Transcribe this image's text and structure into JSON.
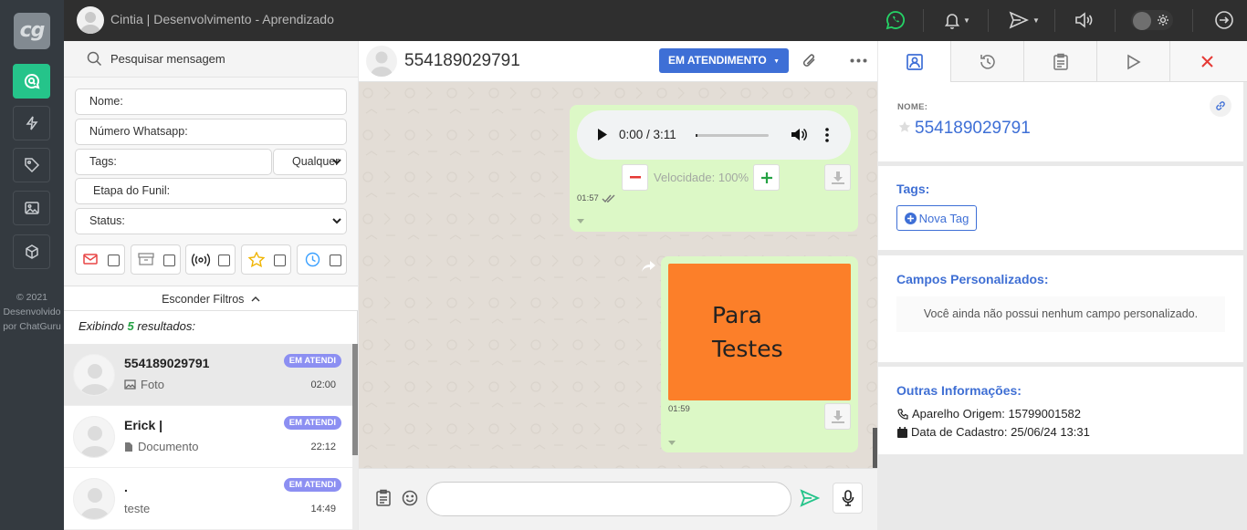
{
  "app": {
    "logo_text": "cg",
    "copyright_lines": [
      "© 2021",
      "Desenvolvido",
      "por ChatGuru"
    ]
  },
  "topbar": {
    "title": "Cintia | Desenvolvimento - Aprendizado"
  },
  "sidebar": {
    "items": [
      {
        "name": "chat",
        "icon": "chat-search-icon",
        "active": true
      },
      {
        "name": "automations",
        "icon": "lightning-icon",
        "active": false
      },
      {
        "name": "tags",
        "icon": "tag-icon",
        "active": false
      },
      {
        "name": "media",
        "icon": "image-icon",
        "active": false
      },
      {
        "name": "integrations",
        "icon": "cube-icon",
        "active": false
      }
    ]
  },
  "search": {
    "placeholder": "Pesquisar mensagem"
  },
  "filters": {
    "name_placeholder": "Nome:",
    "phone_placeholder": "Número Whatsapp:",
    "tags_placeholder": "Tags:",
    "tags_mode": "Qualquer",
    "funnel_placeholder": "Etapa do Funil:",
    "status_placeholder": "Status:",
    "icon_filters": [
      "mail-icon",
      "archive-icon",
      "broadcast-icon",
      "star-icon",
      "clock-icon"
    ],
    "hide_label": "Esconder Filtros"
  },
  "results": {
    "prefix": "Exibindo",
    "count": "5",
    "suffix": "resultados:"
  },
  "chats": [
    {
      "name": "554189029791",
      "preview": "Foto",
      "preview_icon": "image-icon",
      "badge": "EM ATENDI",
      "time": "02:00",
      "selected": true
    },
    {
      "name": "Erick |",
      "preview": "Documento",
      "preview_icon": "document-icon",
      "badge": "EM ATENDI",
      "time": "22:12",
      "selected": false
    },
    {
      "name": ".",
      "preview": "teste",
      "preview_icon": "",
      "badge": "EM ATENDI",
      "time": "14:49",
      "selected": false
    }
  ],
  "conversation": {
    "contact": "554189029791",
    "status_button": "EM ATENDIMENTO",
    "messages": [
      {
        "type": "audio",
        "time_display": "0:00 / 3:11",
        "speed_label": "Velocidade: 100%",
        "sent_at": "01:57"
      },
      {
        "type": "image",
        "image_text_line1": "Para",
        "image_text_line2": "Testes",
        "sent_at": "01:59"
      }
    ]
  },
  "details": {
    "tabs": [
      "contact-card-icon",
      "history-icon",
      "clipboard-icon",
      "play-icon",
      "close-icon"
    ],
    "name_label": "NOME:",
    "name_value": "554189029791",
    "tags_title": "Tags:",
    "new_tag_button": "Nova Tag",
    "custom_fields_title": "Campos Personalizados:",
    "custom_fields_empty": "Você ainda não possui nenhum campo personalizado.",
    "other_info_title": "Outras Informações:",
    "device_origin": "Aparelho Origem: 15799001582",
    "registered_at": "Data de Cadastro: 25/06/24 13:31"
  },
  "colors": {
    "accent_green": "#25c48a",
    "brand_blue": "#3e6fd6",
    "badge_purple": "#8c8ff2",
    "bubble_green": "#dcf8c6",
    "close_red": "#e53935"
  }
}
